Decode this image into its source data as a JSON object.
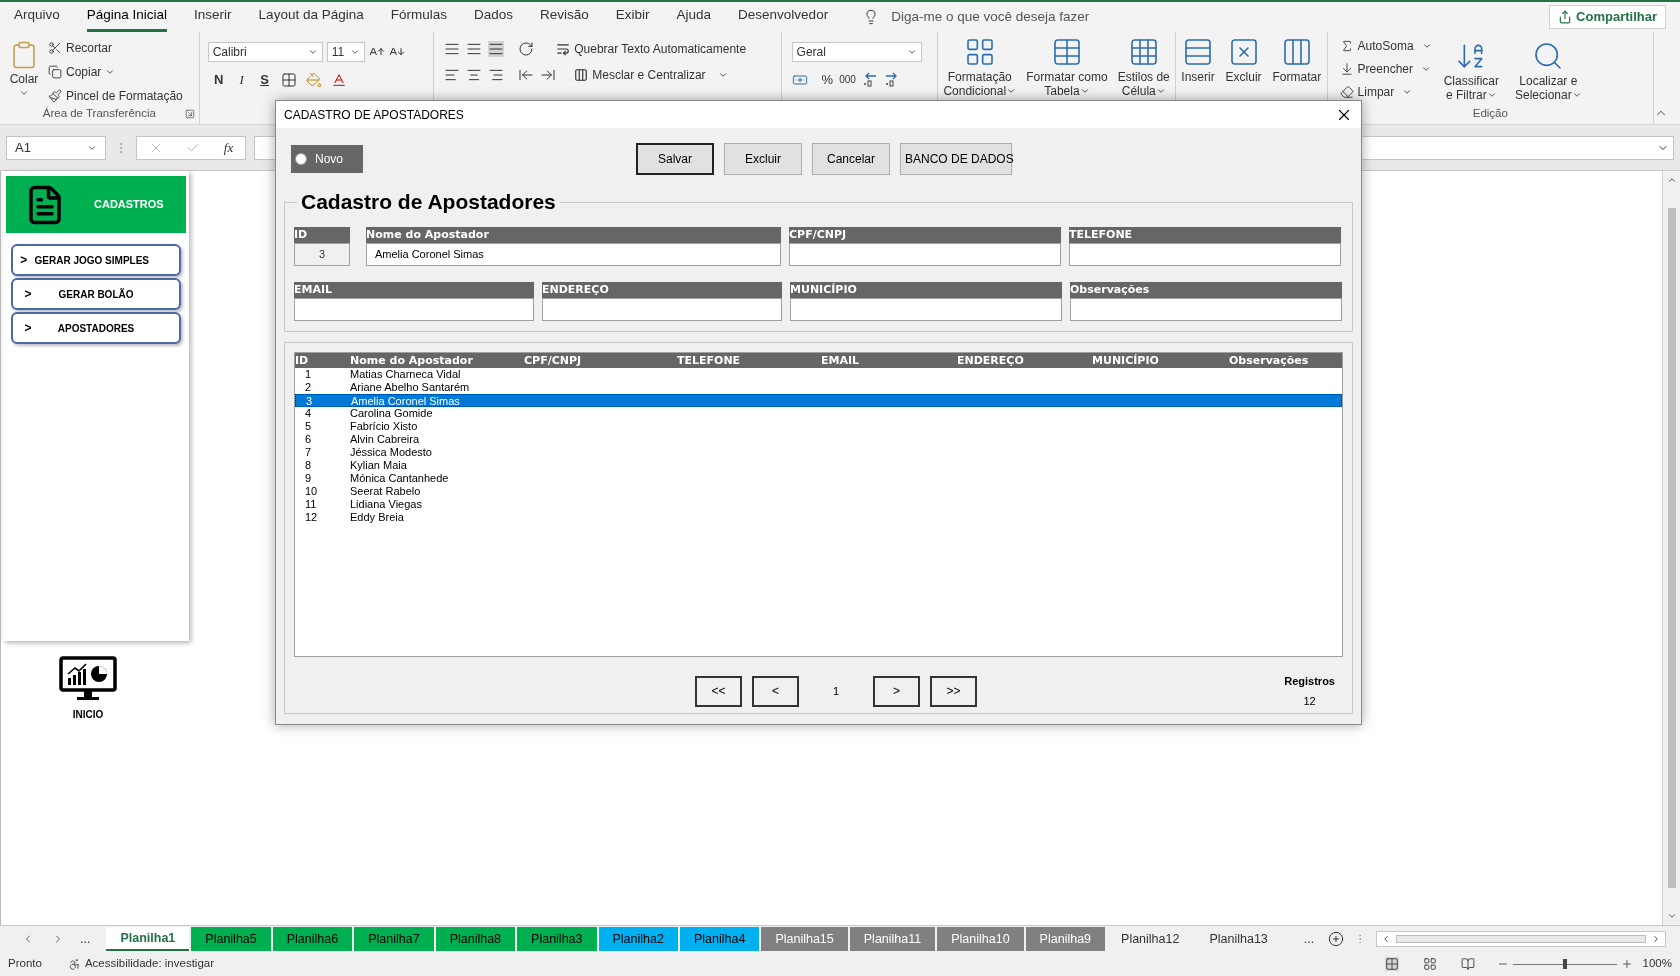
{
  "menu_tabs": [
    {
      "label": "Arquivo",
      "selected": false
    },
    {
      "label": "Página Inicial",
      "selected": true
    },
    {
      "label": "Inserir",
      "selected": false
    },
    {
      "label": "Layout da Página",
      "selected": false
    },
    {
      "label": "Fórmulas",
      "selected": false
    },
    {
      "label": "Dados",
      "selected": false
    },
    {
      "label": "Revisão",
      "selected": false
    },
    {
      "label": "Exibir",
      "selected": false
    },
    {
      "label": "Ajuda",
      "selected": false
    },
    {
      "label": "Desenvolvedor",
      "selected": false
    }
  ],
  "tell_me": "Diga-me o que você deseja fazer",
  "share_button": "Compartilhar",
  "ribbon": {
    "clipboard": {
      "paste": "Colar",
      "actions": [
        "Recortar",
        "Copiar",
        "Pincel de Formatação"
      ],
      "label": "Área de Transferência"
    },
    "font": {
      "name": "Calibri",
      "size": "11",
      "styles": [
        "N",
        "I",
        "S"
      ]
    },
    "alignment": {
      "wrap": "Quebrar Texto Automaticamente",
      "merge": "Mesclar e Centralizar"
    },
    "number": {
      "format": "Geral",
      "percent": "%",
      "thousands": "000"
    },
    "styles": [
      {
        "line1": "Formatação",
        "line2": "Condicional"
      },
      {
        "line1": "Formatar como",
        "line2": "Tabela"
      },
      {
        "line1": "Estilos de",
        "line2": "Célula"
      }
    ],
    "cells": [
      "Inserir",
      "Excluir",
      "Formatar"
    ],
    "editing": {
      "actions": [
        "AutoSoma",
        "Preencher",
        "Limpar"
      ],
      "sort": {
        "line1": "Classificar",
        "line2": "e Filtrar"
      },
      "find": {
        "line1": "Localizar e",
        "line2": "Selecionar"
      },
      "label": "Edição"
    }
  },
  "formula_bar": {
    "name_box": "A1",
    "fx": "fx"
  },
  "side_panel": {
    "header": "CADASTROS",
    "items": [
      {
        "marker": ">",
        "label": "GERAR JOGO SIMPLES"
      },
      {
        "marker": ">",
        "label": "GERAR BOLÃO"
      },
      {
        "marker": ">",
        "label": "APOSTADORES"
      }
    ],
    "home_label": "INICIO"
  },
  "dialog": {
    "title": "CADASTRO DE APOSTADORES",
    "novo": {
      "label": "Novo",
      "checked": false
    },
    "buttons": [
      {
        "label": "Salvar",
        "default": true
      },
      {
        "label": "Excluir",
        "default": false
      },
      {
        "label": "Cancelar",
        "default": false
      },
      {
        "label": "BANCO DE DADOS",
        "default": false
      }
    ],
    "form_title": "Cadastro de Apostadores",
    "fields": [
      {
        "label": "ID",
        "value": "3",
        "disabled": true
      },
      {
        "label": "Nome do Apostador",
        "value": "Amelia Coronel Simas",
        "disabled": false
      },
      {
        "label": "CPF/CNPJ",
        "disabled": false
      },
      {
        "label": "TELEFONE",
        "disabled": false
      },
      {
        "label": "EMAIL",
        "disabled": false
      },
      {
        "label": "ENDEREÇO",
        "disabled": false
      },
      {
        "label": "MUNICÍPIO",
        "disabled": false
      },
      {
        "label": "Observações",
        "disabled": false
      }
    ],
    "list": {
      "columns": [
        "ID",
        "Nome do Apostador",
        "CPF/CNPJ",
        "TELEFONE",
        "EMAIL",
        "ENDEREÇO",
        "MUNICÍPIO",
        "Observações"
      ],
      "rows": [
        {
          "id": "1",
          "name": "Matias Charneca Vidal",
          "selected": false
        },
        {
          "id": "2",
          "name": "Ariane Abelho Santarém",
          "selected": false
        },
        {
          "id": "3",
          "name": "Amelia Coronel Simas",
          "selected": true
        },
        {
          "id": "4",
          "name": "Carolina Gomide",
          "selected": false
        },
        {
          "id": "5",
          "name": "Fabrício Xisto",
          "selected": false
        },
        {
          "id": "6",
          "name": "Alvin Cabreira",
          "selected": false
        },
        {
          "id": "7",
          "name": "Jéssica Modesto",
          "selected": false
        },
        {
          "id": "8",
          "name": "Kylian Maia",
          "selected": false
        },
        {
          "id": "9",
          "name": "Mónica Cantanhede",
          "selected": false
        },
        {
          "id": "10",
          "name": "Seerat Rabelo",
          "selected": false
        },
        {
          "id": "11",
          "name": "Lidiana Viegas",
          "selected": false
        },
        {
          "id": "12",
          "name": "Eddy Breia",
          "selected": false
        }
      ]
    },
    "pagination": {
      "first": "<<",
      "prev": "<",
      "page": "1",
      "next": ">",
      "last": ">>"
    },
    "records": {
      "label": "Registros",
      "count": "12"
    }
  },
  "sheet_tabs_more_left": "...",
  "sheet_tabs": [
    {
      "label": "Planilha1",
      "selected": true
    },
    {
      "label": "Planilha5",
      "selected": false,
      "color": "#00b050"
    },
    {
      "label": "Planilha6",
      "selected": false,
      "color": "#00b050"
    },
    {
      "label": "Planilha7",
      "selected": false,
      "color": "#00b050"
    },
    {
      "label": "Planilha8",
      "selected": false,
      "color": "#00b050"
    },
    {
      "label": "Planilha3",
      "selected": false,
      "color": "#00b050"
    },
    {
      "label": "Planilha2",
      "selected": false,
      "color": "#00b0f0"
    },
    {
      "label": "Planilha4",
      "selected": false,
      "color": "#00b0f0"
    },
    {
      "label": "Planilha15",
      "selected": false,
      "color": "#808080"
    },
    {
      "label": "Planilha11",
      "selected": false,
      "color": "#808080"
    },
    {
      "label": "Planilha10",
      "selected": false,
      "color": "#808080"
    },
    {
      "label": "Planilha9",
      "selected": false,
      "color": "#808080"
    },
    {
      "label": "Planilha12",
      "selected": false
    },
    {
      "label": "Planilha13",
      "selected": false
    }
  ],
  "sheet_tabs_more_right": "...",
  "status_bar": {
    "status": "Pronto",
    "accessibility": "Acessibilidade: investigar",
    "zoom": "100%",
    "zoom_slider": {
      "level": 0.5
    }
  }
}
